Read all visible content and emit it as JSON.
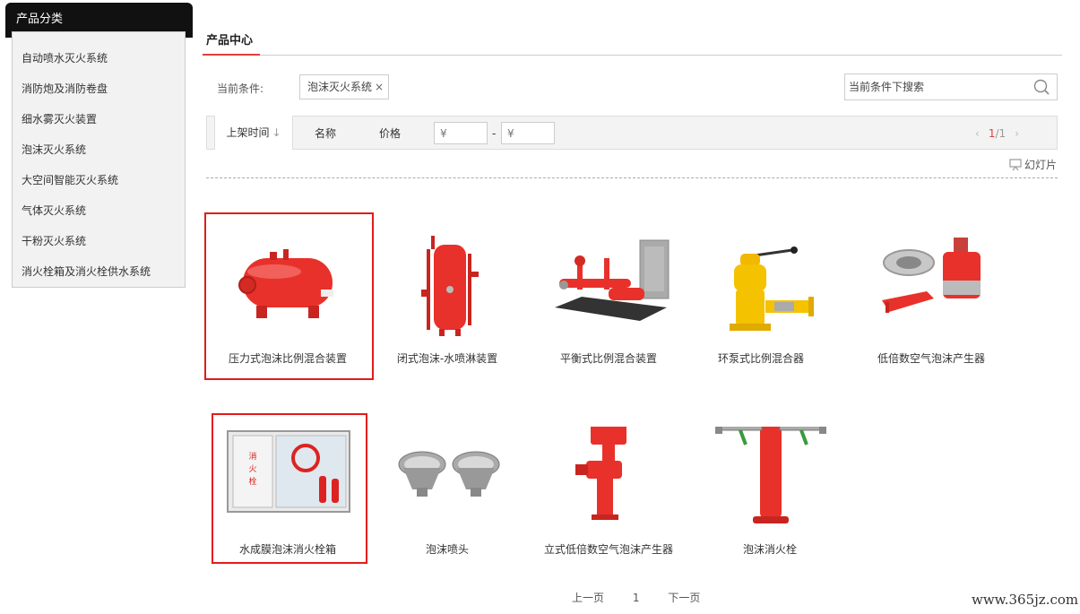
{
  "sidebar": {
    "title": "产品分类",
    "items": [
      {
        "label": "自动喷水灭火系统"
      },
      {
        "label": "消防炮及消防卷盘"
      },
      {
        "label": "细水雾灭火装置"
      },
      {
        "label": "泡沫灭火系统"
      },
      {
        "label": "大空间智能灭火系统"
      },
      {
        "label": "气体灭火系统"
      },
      {
        "label": "干粉灭火系统"
      },
      {
        "label": "消火栓箱及消火栓供水系统"
      }
    ]
  },
  "main": {
    "title": "产品中心",
    "condition_label": "当前条件:",
    "condition_tag": "泡沫灭火系统",
    "condition_remove": "×",
    "search_placeholder": "当前条件下搜索",
    "sort": {
      "time": "上架时间",
      "time_arrow": "↓",
      "name": "名称",
      "price": "价格",
      "price_from": "¥",
      "price_to": "¥",
      "dash": "-",
      "page_current": "1",
      "page_total": "/1",
      "prev": "‹",
      "next": "›"
    },
    "slideshow": "幻灯片"
  },
  "products": [
    {
      "name": "压力式泡沫比例混合装置",
      "icon": "pressure-tank",
      "highlighted": true
    },
    {
      "name": "闭式泡沫-水喷淋装置",
      "icon": "vertical-tank",
      "highlighted": false
    },
    {
      "name": "平衡式比例混合装置",
      "icon": "skid-unit",
      "highlighted": false
    },
    {
      "name": "环泵式比例混合器",
      "icon": "yellow-valve",
      "highlighted": false
    },
    {
      "name": "低倍数空气泡沫产生器",
      "icon": "foam-generator",
      "highlighted": false
    },
    {
      "name": "水成膜泡沫消火栓箱",
      "icon": "hydrant-cabinet",
      "highlighted": true
    },
    {
      "name": "泡沫喷头",
      "icon": "foam-nozzle",
      "highlighted": false
    },
    {
      "name": "立式低倍数空气泡沫产生器",
      "icon": "vertical-generator",
      "highlighted": false
    },
    {
      "name": "泡沫消火栓",
      "icon": "fire-hydrant",
      "highlighted": false
    }
  ],
  "pager": {
    "prev": "上一页",
    "page": "1",
    "next": "下一页"
  },
  "watermark": "www.365jz.com",
  "colors": {
    "accent": "#e0403a",
    "highlight_border": "#e31b1b",
    "product_red": "#e8312b"
  }
}
